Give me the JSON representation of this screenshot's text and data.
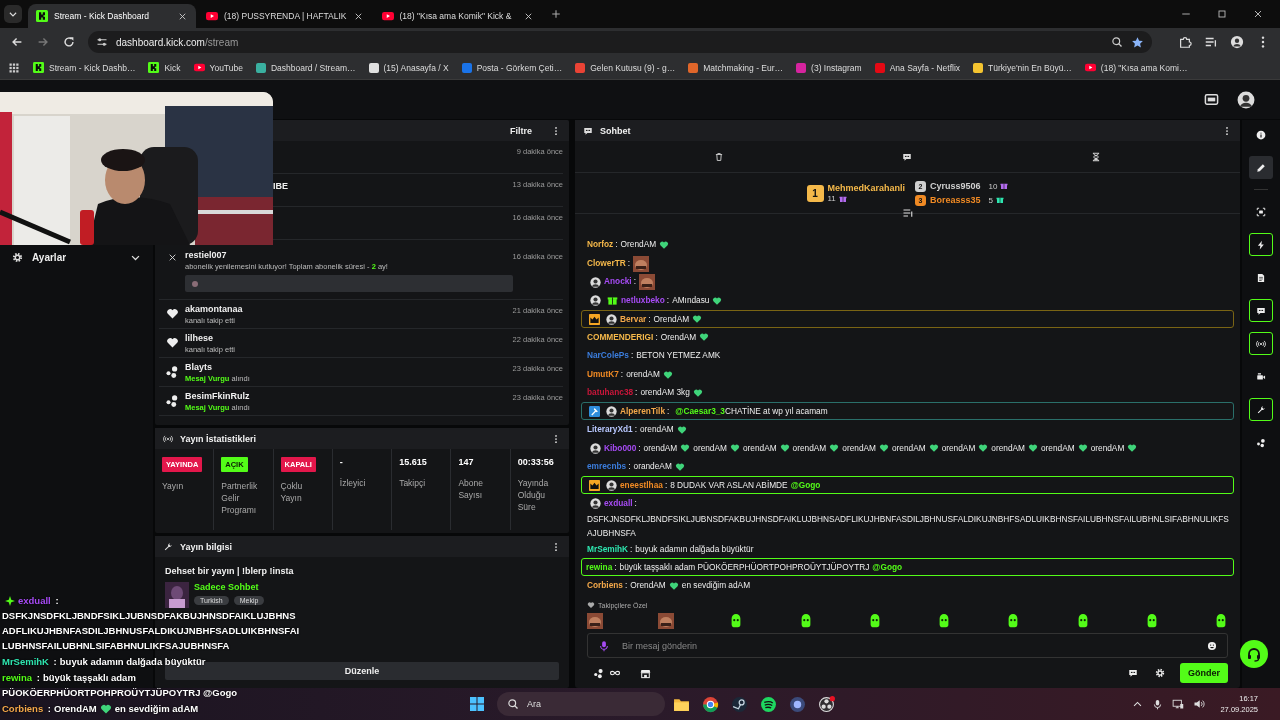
{
  "browser": {
    "tabs": [
      {
        "title": "Stream - Kick Dashboard",
        "kind": "logo",
        "selected": true
      },
      {
        "title": "(18) PUSSYRENDA | HAFTALIK",
        "kind": "play",
        "selected": false
      },
      {
        "title": "(18) \"Kısa ama Komik\" Kick &",
        "kind": "play",
        "selected": false
      }
    ],
    "host": "dashboard.kick.com",
    "path": "/stream",
    "bookmarks": [
      {
        "label": "Stream - Kick Dashb…",
        "kind": "logo"
      },
      {
        "label": "Kick",
        "kind": "logo"
      },
      {
        "label": "YouTube",
        "kind": "play"
      },
      {
        "label": "Dashboard / Stream…",
        "kind": "square",
        "color": "#3ab0a0"
      },
      {
        "label": "(15) Anasayfa / X",
        "kind": "square",
        "color": "#e0e0e0"
      },
      {
        "label": "Posta - Görkem Çeti…",
        "kind": "square",
        "color": "#1a73e8"
      },
      {
        "label": "Gelen Kutusu (9) - g…",
        "kind": "square",
        "color": "#ea4335"
      },
      {
        "label": "Matchmaking - Eur…",
        "kind": "square",
        "color": "#e0662a"
      },
      {
        "label": "(3) Instagram",
        "kind": "square",
        "color": "#d6249f"
      },
      {
        "label": "Ana Sayfa - Netflix",
        "kind": "square",
        "color": "#e50914"
      },
      {
        "label": "Türkiye'nin En Büyü…",
        "kind": "square",
        "color": "#f4c430"
      },
      {
        "label": "(18) \"Kısa ama Komi…",
        "kind": "play"
      }
    ]
  },
  "sidebar": {
    "label": "Ayarlar"
  },
  "activity": {
    "filter": "Filtre",
    "items": [
      {
        "kind": "covered",
        "time": "9 dakika önce"
      },
      {
        "kind": "covered",
        "name": "IBE",
        "time": "13 dakika önce"
      },
      {
        "kind": "covered",
        "time": "16 dakika önce"
      },
      {
        "kind": "sub",
        "name": "restiel007",
        "text_before": "abonelik yenilemesini kutluyor! Toplam abonelik süresi - ",
        "months": "2",
        "text_after": " ay!",
        "time": "16 dakika önce"
      },
      {
        "kind": "follow",
        "name": "akamontanaa",
        "text": "kanalı takip etti",
        "time": "21 dakika önce"
      },
      {
        "kind": "follow",
        "name": "lilhese",
        "text": "kanalı takip etti",
        "time": "22 dakika önce"
      },
      {
        "kind": "highlight",
        "name": "Blayts",
        "highlight": "Mesaj Vurgu",
        "text": " alındı",
        "time": "23 dakika önce"
      },
      {
        "kind": "highlight",
        "name": "BesimFkinRulz",
        "highlight": "Mesaj Vurgu",
        "text": " alındı",
        "time": "23 dakika önce"
      }
    ]
  },
  "stats": {
    "title": "Yayın İstatistikleri",
    "cells": [
      {
        "kind": "badge",
        "badge": "YAYINDA",
        "color": "#e3174b",
        "label": "Yayın"
      },
      {
        "kind": "badge",
        "badge": "AÇIK",
        "color": "#53fc18",
        "label": "Partnerlik Gelir Programı"
      },
      {
        "kind": "badge",
        "badge": "KAPALI",
        "color": "#e3174b",
        "label": "Çoklu Yayın"
      },
      {
        "kind": "value",
        "value": "-",
        "label": "İzleyici"
      },
      {
        "kind": "value",
        "value": "15.615",
        "label": "Takipçi"
      },
      {
        "kind": "value",
        "value": "147",
        "label": "Abone Sayısı"
      },
      {
        "kind": "value",
        "value": "00:33:56",
        "label": "Yayında Olduğu Süre"
      }
    ]
  },
  "info": {
    "title": "Yayın bilgisi",
    "stream_title": "Dehset bir yayın | !blerp !insta",
    "category": "Sadece Sohbet",
    "tags": [
      "Turkish",
      "Mekip"
    ],
    "button": "Düzenle"
  },
  "chat": {
    "title": "Sohbet",
    "leaders": [
      {
        "rank": "1",
        "name": "MehmedKarahanli",
        "count": "11",
        "color": "#f5b94a",
        "gift": {
          "color": "#b46cf0"
        }
      },
      {
        "rank": "2",
        "name": "Cyruss9506",
        "count": "10",
        "color": "#cfcfcf",
        "gift": {
          "color": "#b46cf0"
        }
      },
      {
        "rank": "3",
        "name": "Boreasss35",
        "count": "5",
        "color": "#f08a24",
        "gift": {
          "color": "#2ee6b0"
        }
      }
    ],
    "messages": [
      {
        "name": "Norfoz",
        "color": "#f5b84a",
        "sep": ":",
        "parts": [
          {
            "kind": "text",
            "text": "OrendAM"
          },
          {
            "kind": "heart"
          }
        ]
      },
      {
        "name": "ClowerTR",
        "color": "#f5b84a",
        "sep": ":",
        "parts": [
          {
            "kind": "emote"
          }
        ]
      },
      {
        "name": "Anocki",
        "color": "#a64bf4",
        "badges": [
          {
            "kind": "avatar"
          }
        ],
        "sep": ":",
        "parts": [
          {
            "kind": "emote"
          }
        ]
      },
      {
        "name": "netluxbeko",
        "color": "#a64bf4",
        "badges": [
          {
            "kind": "avatar"
          },
          {
            "kind": "gift"
          }
        ],
        "sep": ":",
        "parts": [
          {
            "kind": "text",
            "text": "AMındasu"
          },
          {
            "kind": "heart"
          }
        ]
      },
      {
        "name": "Bervar",
        "color": "#f5a94a",
        "badges": [
          {
            "kind": "crown"
          },
          {
            "kind": "avatar"
          }
        ],
        "highlight": {
          "color": "#7a6414"
        },
        "sep": ":",
        "parts": [
          {
            "kind": "text",
            "text": "OrendAM"
          },
          {
            "kind": "heart"
          }
        ]
      },
      {
        "name": "COMMENDERIGI",
        "color": "#f5b84a",
        "sep": ":",
        "parts": [
          {
            "kind": "text",
            "text": "OrendAM"
          },
          {
            "kind": "heart"
          }
        ]
      },
      {
        "name": "NarColePs",
        "color": "#3b7ddd",
        "sep": ":",
        "parts": [
          {
            "kind": "text",
            "text": "BETON YETMEZ AMK"
          }
        ]
      },
      {
        "name": "UmutK7",
        "color": "#f08a24",
        "sep": ":",
        "parts": [
          {
            "kind": "text",
            "text": "orendAM"
          },
          {
            "kind": "heart"
          }
        ]
      },
      {
        "name": "batuhanc38",
        "color": "#c9163a",
        "sep": ":",
        "parts": [
          {
            "kind": "text",
            "text": "orendAM 3kg"
          },
          {
            "kind": "heart"
          }
        ]
      },
      {
        "name": "AlperenTilk",
        "color": "#f5a94a",
        "badges": [
          {
            "kind": "hammer"
          },
          {
            "kind": "avatar"
          }
        ],
        "highlight": {
          "color": "#2a6f6a"
        },
        "sep": ":",
        "parts": [
          {
            "kind": "mention",
            "text": "@Caesar3_3"
          },
          {
            "kind": "text",
            "text": "CHATİNE at wp yıl acamam"
          }
        ]
      },
      {
        "name": "LiteraryXd1",
        "color": "#b9c8ff",
        "sep": ":",
        "parts": [
          {
            "kind": "text",
            "text": "orendAM"
          },
          {
            "kind": "heart"
          }
        ]
      },
      {
        "name": "Kibo000",
        "color": "#a64bf4",
        "badges": [
          {
            "kind": "avatar"
          }
        ],
        "sep": ":",
        "parts": [
          {
            "kind": "text",
            "text": "orendAM"
          },
          {
            "kind": "heart"
          },
          {
            "kind": "text",
            "text": "orendAM"
          },
          {
            "kind": "heart"
          },
          {
            "kind": "text",
            "text": "orendAM"
          },
          {
            "kind": "heart"
          },
          {
            "kind": "text",
            "text": "orendAM"
          },
          {
            "kind": "heart"
          },
          {
            "kind": "text",
            "text": "orendAM"
          },
          {
            "kind": "heart"
          },
          {
            "kind": "text",
            "text": "orendAM"
          },
          {
            "kind": "heart"
          },
          {
            "kind": "text",
            "text": "orendAM"
          },
          {
            "kind": "heart"
          },
          {
            "kind": "text",
            "text": "orendAM"
          },
          {
            "kind": "heart"
          },
          {
            "kind": "text",
            "text": "orendAM"
          },
          {
            "kind": "heart"
          },
          {
            "kind": "text",
            "text": "orendAM"
          },
          {
            "kind": "heart"
          }
        ]
      },
      {
        "name": "emrecnbs",
        "color": "#3b7ddd",
        "sep": ":",
        "parts": [
          {
            "kind": "text",
            "text": "orandeAM"
          },
          {
            "kind": "heart"
          }
        ]
      },
      {
        "name": "eneestlhaa",
        "color": "#f08a24",
        "badges": [
          {
            "kind": "crown"
          },
          {
            "kind": "avatar"
          }
        ],
        "highlight": {
          "color": "#53fc18"
        },
        "sep": ":",
        "parts": [
          {
            "kind": "text",
            "text": "8 DUDAK VAR ASLAN ABİMDE"
          },
          {
            "kind": "mention",
            "text": "@Gogo"
          }
        ]
      },
      {
        "name": "exduall",
        "color": "#a64bf4",
        "badges": [
          {
            "kind": "avatar"
          }
        ],
        "sep": ":",
        "parts": [
          {
            "kind": "block",
            "text": "DSFKJNSDFKLJBNDFSIKLJUBNSDFAKBUJHNSDFAIKLUJBHNSADFLIKUJHBNFASDILJBHNUSFALDIKUJNBHFSADLUIKBHNSFAILUBHNSFAILUBHNLSIFABHNULIKFSAJUBHNSFA"
          }
        ]
      },
      {
        "name": "MrSemihK",
        "color": "#2ee6b0",
        "sep": ":",
        "parts": [
          {
            "kind": "text",
            "text": "buyuk adamın dalğada büyüktür"
          }
        ]
      },
      {
        "name": "rewina",
        "color": "#53fc18",
        "highlight": {
          "color": "#53fc18"
        },
        "sep": ":",
        "parts": [
          {
            "kind": "text",
            "text": "büyük taşşaklı adam PÜOKÖERPHÜORTPOHPROÜYTJÜPOYTRJ"
          },
          {
            "kind": "mention",
            "text": "@Gogo"
          }
        ]
      },
      {
        "name": "Corbiens",
        "color": "#f5a94a",
        "sep": ":",
        "parts": [
          {
            "kind": "text",
            "text": "OrendAM"
          },
          {
            "kind": "heart"
          },
          {
            "kind": "text",
            "text": "en sevdiğim adAM"
          }
        ]
      }
    ],
    "followers_label": "Takipçilere Özel",
    "emotes": [
      {
        "kind": "picture"
      },
      {
        "kind": "picture"
      },
      {
        "kind": "blob"
      },
      {
        "kind": "blob"
      },
      {
        "kind": "blob"
      },
      {
        "kind": "blob"
      },
      {
        "kind": "blob"
      },
      {
        "kind": "blob"
      },
      {
        "kind": "blob"
      },
      {
        "kind": "blob"
      }
    ],
    "placeholder": "Bir mesaj gönderin",
    "send": "Gönder"
  },
  "rail": [
    {
      "kind": "info",
      "selected": false,
      "outlined": false
    },
    {
      "kind": "pencil",
      "selected": true,
      "outlined": false
    },
    {
      "kind": "screen",
      "selected": false,
      "outlined": false
    },
    {
      "kind": "bolt",
      "selected": false,
      "outlined": true
    },
    {
      "kind": "doc",
      "selected": false,
      "outlined": false
    },
    {
      "kind": "chat",
      "selected": false,
      "outlined": true
    },
    {
      "kind": "broadcast",
      "selected": false,
      "outlined": true
    },
    {
      "kind": "camera",
      "selected": false,
      "outlined": false
    },
    {
      "kind": "wrench",
      "selected": false,
      "outlined": true
    },
    {
      "kind": "bubbles",
      "selected": false,
      "outlined": false
    }
  ],
  "stream_overlay": [
    {
      "name": "exduall",
      "color": "#a64bf4",
      "badges": [
        {
          "kind": "sparkle"
        }
      ],
      "sep": " :",
      "parts": [
        {
          "kind": "block",
          "text": "DSFKJNSDFKLJBNDFSIKLJUBNSDFAKBUJHNSDFAIKLUJBHNSADFLIKUJHBNFASDILJBHNUSFALDIKUJNBHFSADLUIKBHNSFAILUBHNSFAILUBHNLSIFABHNULIKFSAJUBHNSFA"
        }
      ]
    },
    {
      "name": "MrSemihK",
      "color": "#2ee6b0",
      "sep": " :",
      "parts": [
        {
          "kind": "text",
          "text": "buyuk adamın dalğada büyüktür"
        }
      ]
    },
    {
      "name": "rewina",
      "color": "#53fc18",
      "sep": " :",
      "parts": [
        {
          "kind": "text",
          "text": "büyük taşşaklı adam"
        },
        {
          "kind": "block",
          "text": "PÜOKÖERPHÜORTPOHPROÜYTJÜPOYTRJ @Gogo"
        }
      ]
    },
    {
      "name": "Corbiens",
      "color": "#f5a94a",
      "sep": " :",
      "parts": [
        {
          "kind": "text",
          "text": "OrendAM"
        },
        {
          "kind": "heart"
        },
        {
          "kind": "text",
          "text": "en sevdiğim adAM"
        }
      ]
    }
  ],
  "taskbar": {
    "search": "Ara",
    "time": "16:17",
    "date": "27.09.2025"
  }
}
